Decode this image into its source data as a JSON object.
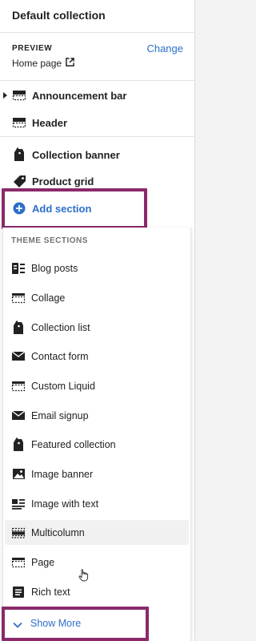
{
  "header": {
    "title": "Default collection"
  },
  "preview": {
    "label": "PREVIEW",
    "change_label": "Change",
    "page": "Home page"
  },
  "sections": [
    {
      "label": "Announcement bar",
      "icon": "section-outline-icon"
    },
    {
      "label": "Header",
      "icon": "header-icon"
    },
    {
      "label": "Collection banner",
      "icon": "collection-tag-icon"
    },
    {
      "label": "Product grid",
      "icon": "price-tag-icon"
    }
  ],
  "add_section": {
    "label": "Add section"
  },
  "dropdown": {
    "heading": "THEME SECTIONS",
    "items": [
      {
        "label": "Blog posts",
        "icon": "blog-icon"
      },
      {
        "label": "Collage",
        "icon": "section-outline-icon"
      },
      {
        "label": "Collection list",
        "icon": "collection-tag-icon"
      },
      {
        "label": "Contact form",
        "icon": "envelope-icon"
      },
      {
        "label": "Custom Liquid",
        "icon": "section-outline-icon"
      },
      {
        "label": "Email signup",
        "icon": "envelope-icon"
      },
      {
        "label": "Featured collection",
        "icon": "collection-tag-icon"
      },
      {
        "label": "Image banner",
        "icon": "image-icon"
      },
      {
        "label": "Image with text",
        "icon": "image-text-icon"
      },
      {
        "label": "Multicolumn",
        "icon": "section-outline-icon"
      },
      {
        "label": "Page",
        "icon": "section-outline-icon"
      },
      {
        "label": "Rich text",
        "icon": "rich-text-icon"
      }
    ],
    "show_more_label": "Show More"
  },
  "colors": {
    "accent": "#2c6ecb",
    "highlight": "#8a2a6a",
    "text": "#202223",
    "muted": "#6d7175"
  }
}
